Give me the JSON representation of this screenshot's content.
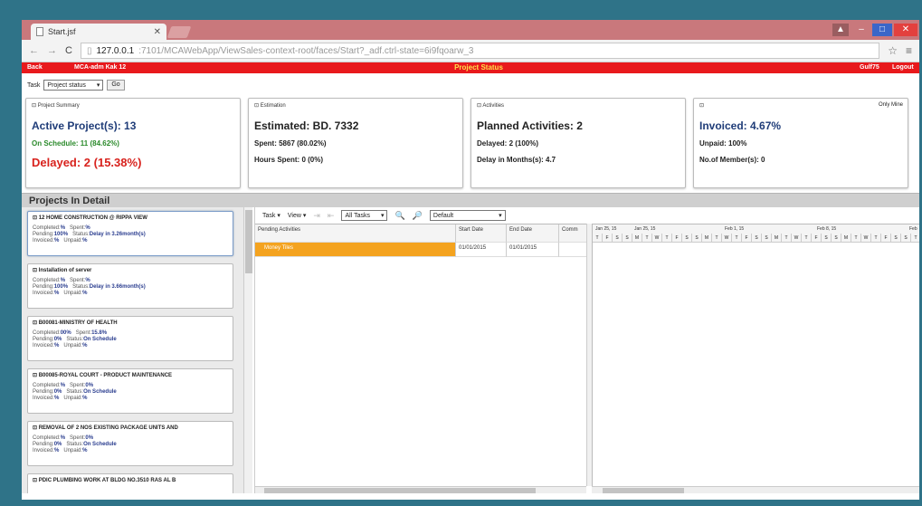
{
  "browser": {
    "tab_title": "Start.jsf",
    "url_host": "127.0.0.1",
    "url_rest": ":7101/MCAWebApp/ViewSales-context-root/faces/Start?_adf.ctrl-state=6i9fqoarw_3"
  },
  "appbar": {
    "left1": "Back",
    "left2": "MCA-adm Kak 12",
    "title": "Project Status",
    "right1": "Gulf75",
    "right2": "Logout"
  },
  "task": {
    "label": "Task",
    "selected": "Project status",
    "go": "Go"
  },
  "cards": {
    "summary": {
      "header": "Project Summary",
      "active": "Active Project(s): 13",
      "on_schedule": "On Schedule: 11 (84.62%)",
      "delayed": "Delayed: 2 (15.38%)"
    },
    "estimation": {
      "header": "Estimation",
      "estimated": "Estimated: BD. 7332",
      "spent": "Spent: 5867 (80.02%)",
      "hours": "Hours Spent: 0 (0%)"
    },
    "activities": {
      "header": "Activities",
      "planned": "Planned Activities: 2",
      "delayed": "Delayed: 2 (100%)",
      "delay_months": "Delay in Months(s): 4.7"
    },
    "invoice": {
      "corner": "Only Mine",
      "invoiced": "Invoiced: 4.67%",
      "unpaid": "Unpaid: 100%",
      "members": "No.of Member(s): 0"
    }
  },
  "section_title": "Projects In Detail",
  "projects": [
    {
      "name": "12 HOME CONSTRUCTION @ RIPPA VIEW",
      "completed": "%",
      "spent": "%",
      "pending": "100%",
      "status": "Delay in 3.26month(s)",
      "invoiced": "%",
      "unpaid": "%"
    },
    {
      "name": "Installation of server",
      "completed": "%",
      "spent": "%",
      "pending": "100%",
      "status": "Delay in 3.66month(s)",
      "invoiced": "%",
      "unpaid": "%"
    },
    {
      "name": "B00081-MINISTRY OF HEALTH",
      "completed": "00%",
      "spent": "15.8%",
      "pending": "0%",
      "status": "On Schedule",
      "invoiced": "%",
      "unpaid": "%"
    },
    {
      "name": "B00085-ROYAL COURT - PRODUCT MAINTENANCE",
      "completed": "%",
      "spent": "0%",
      "pending": "0%",
      "status": "On Schedule",
      "invoiced": "%",
      "unpaid": "%"
    },
    {
      "name": "REMOVAL OF 2 NOS EXISTING PACKAGE UNITS AND",
      "completed": "%",
      "spent": "0%",
      "pending": "0%",
      "status": "On Schedule",
      "invoiced": "%",
      "unpaid": "%"
    },
    {
      "name": "PDIC PLUMBING WORK AT BLDG NO.3510 RAS AL B",
      "completed": "",
      "spent": "",
      "pending": "",
      "status": "",
      "invoiced": "",
      "unpaid": ""
    }
  ],
  "labels": {
    "completed": "Completed:",
    "spent": "Spent:",
    "pending": "Pending:",
    "status": "Status:",
    "invoiced": "Invoiced:",
    "unpaid": "Unpaid:"
  },
  "gantt": {
    "menu_task": "Task ▾",
    "menu_view": "View ▾",
    "filter": "All Tasks",
    "layout": "Default",
    "columns": [
      "Pending Activities",
      "Start Date",
      "End Date",
      "Comm"
    ],
    "rows": [
      {
        "activity": "Money Tiles",
        "start": "01/01/2015",
        "end": "01/01/2015"
      }
    ],
    "weeks": [
      "Jan 25, 15",
      "Jan 25, 15",
      "Feb 1, 15",
      "Feb 8, 15",
      "Feb"
    ],
    "days": [
      "T",
      "F",
      "S",
      "S",
      "M",
      "T",
      "W",
      "T",
      "F",
      "S",
      "S",
      "M",
      "T",
      "W",
      "T",
      "F",
      "S",
      "S",
      "M",
      "T",
      "W",
      "T",
      "F",
      "S",
      "S",
      "M",
      "T",
      "W",
      "T",
      "F",
      "S",
      "S",
      "T"
    ]
  },
  "colors": {
    "frame_bg": "#2f7388",
    "appbar": "#e8191c",
    "activity_bar": "#f4a31f",
    "delayed_red": "#d8221d",
    "on_schedule_green": "#2b8a2b"
  }
}
